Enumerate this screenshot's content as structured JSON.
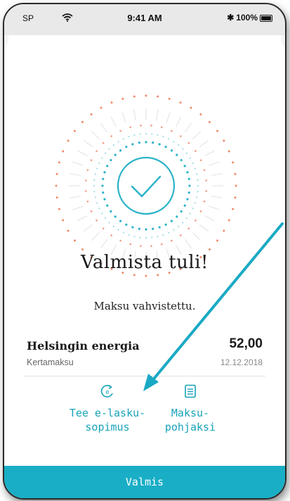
{
  "status_bar": {
    "carrier": "SP",
    "time": "9:41 AM",
    "battery": "100%"
  },
  "confirmation": {
    "title": "Valmista tuli!",
    "subtitle": "Maksu vahvistettu."
  },
  "payment": {
    "payee": "Helsingin energia",
    "type": "Kertamaksu",
    "amount": "52,00",
    "date": "12.12.2018"
  },
  "actions": {
    "einvoice_line1": "Tee e-lasku-",
    "einvoice_line2": "sopimus",
    "template_line1": "Maksu-",
    "template_line2": "pohjaksi"
  },
  "footer": {
    "done_label": "Valmis"
  },
  "icons": {
    "success": "checkmark-circle-icon",
    "einvoice": "e-invoice-icon",
    "template": "document-list-icon"
  },
  "colors": {
    "accent": "#19aec6",
    "burst_orange": "#f08a6a",
    "burst_teal": "#2ab3c8",
    "annotation_arrow": "#1aa9c4"
  }
}
